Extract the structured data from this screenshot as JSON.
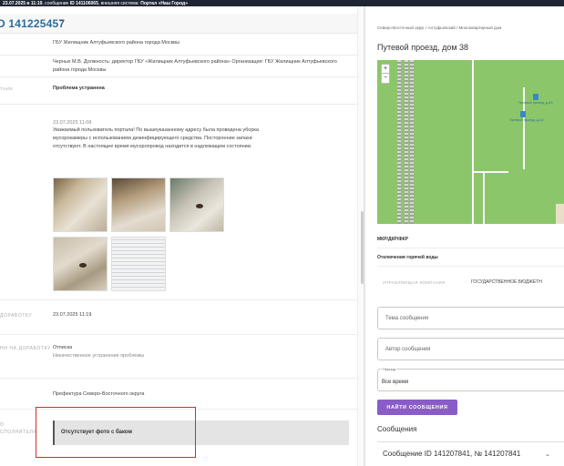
{
  "topbar": {
    "date_bold": "23.07.2025 в 11:19",
    "mid": ", сообщение ",
    "msg_id_bold": "ID 141106065",
    "rest": ", внешняя система: ",
    "system_bold": "Портал «Наш Город»"
  },
  "left": {
    "header_id": "D 141225457",
    "org_name": "ГБУ Жилищник Алтуфьевского района города Москвы",
    "responsible": "Черных М.В. Должность: директор ГБУ «Жилищник Алтуфьевского района» Организация: ГБУ Жилищник Алтуфьевского района города Москвы",
    "status_label": "тние",
    "status_value": "Проблема устранена",
    "answer_date": "23.07.2025 11:08",
    "answer_text": "Уважаемый пользователь портала! По вышеуказанному адресу была проведена уборка мусорокамеры с использованием дезинфицирующего средства. Посторонние запахи отсутствуют. В настоящее время мусоропровод находится в надлежащем состоянии.",
    "rework_label": "доработку",
    "rework_value": "23.07.2025 11:19",
    "rework_reason_label": "ни на доработку",
    "rework_reason_value": "Отписка",
    "rework_reason_detail": "Некачественное устранение проблемы",
    "prefecture_value": "Префектура Северо-Восточного округа",
    "comment_label_1": "о",
    "comment_label_2": "сполнителя",
    "comment_value": "Отсутствует фото с баком"
  },
  "right": {
    "breadcrumb": "Северо-Восточный округ / Алтуфьевский / Многоквартирный дом",
    "title": "Путевой проезд, дом 38",
    "map": {
      "zoom_in": "+",
      "zoom_out": "−",
      "poi_1_label": "Путевой проезд, д.43",
      "poi_2_label": "Путевой проезд, д.43"
    },
    "category": "МКР/ДКР/ФКР",
    "outage": "Отключения горячей воды",
    "company_label": "УПРАВЛЯЮЩАЯ КОМПАНИЯ",
    "company_value": "ГОСУДАРСТВЕННОЕ БЮДЖЕТН",
    "topic_placeholder": "Тема сообщения",
    "author_placeholder": "Автор сообщения",
    "period_legend": "Период",
    "period_value": "Все время",
    "find_button": "НАЙТИ СООБЩЕНИЯ",
    "messages_title": "Сообщения",
    "message_item": "Сообщение ID 141207841, № 141207841",
    "message_chevron": "⌄"
  }
}
